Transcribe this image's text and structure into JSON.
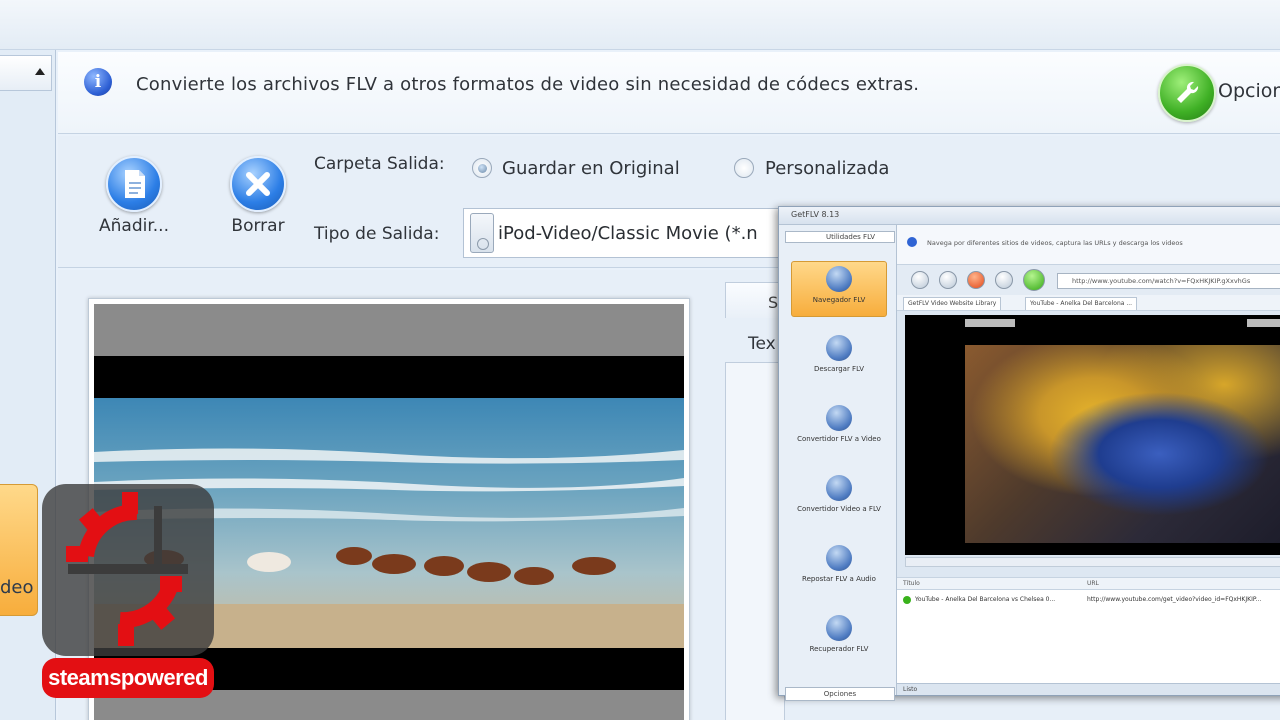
{
  "info": {
    "text": "Convierte los archivos FLV a otros formatos de video sin necesidad de códecs extras.",
    "options_label": "Opcion"
  },
  "left": {
    "active_label": "deo"
  },
  "toolbar": {
    "add_label": "Añadir...",
    "delete_label": "Borrar",
    "output_folder_label": "Carpeta Salida:",
    "radio_original": "Guardar en Original",
    "radio_custom": "Personalizada",
    "radio_selected": "Guardar en Original",
    "output_type_label": "Tipo de Salida:",
    "output_type_value": "iPod-Video/Classic Movie (*.n"
  },
  "content": {
    "tab_label": "S",
    "text_label": "Tex"
  },
  "inset": {
    "title": "GetFLV 8.13",
    "dropdown": "Utilidades FLV",
    "info_text": "Navega por diferentes sitios de videos, captura las URLs y descarga los videos",
    "url": "http://www.youtube.com/watch?v=FQxHKJKIP.gXxvhGs",
    "tabs": [
      "GetFLV Video Website Library",
      "YouTube - Anelka Del Barcelona ..."
    ],
    "sidebar": [
      "Navegador FLV",
      "Descargar FLV",
      "Convertidor FLV a Video",
      "Convertidor Video a FLV",
      "Repostar FLV a Audio",
      "Recuperador FLV"
    ],
    "bottom_dropdown": "Opciones",
    "list_headers": [
      "Título",
      "URL"
    ],
    "list_rows": [
      {
        "title": "YouTube - Anelka Del Barcelona vs Chelsea 0...",
        "url": "http://www.youtube.com/get_video?video_id=FQxHKJKIP..."
      }
    ],
    "status": "Listo"
  },
  "watermark": {
    "text": "steamspowered"
  },
  "colors": {
    "accent_orange": "#f7ad3c",
    "option_green": "#3fb025",
    "button_blue": "#2c7ee6",
    "watermark_red": "#e30f13"
  }
}
